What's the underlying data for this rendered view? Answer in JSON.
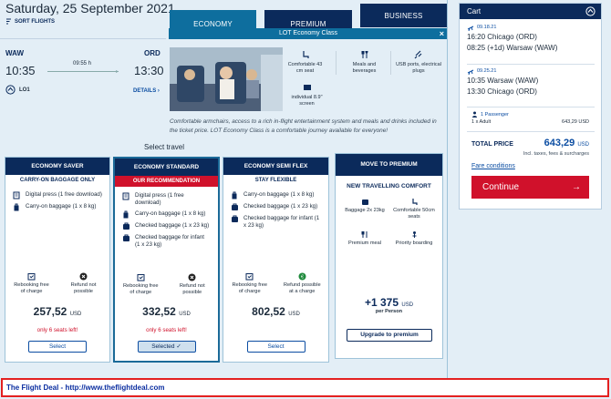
{
  "flight": {
    "date": "Saturday, 25 September 2021",
    "sort_label": "SORT FLIGHTS",
    "origin": "WAW",
    "destination": "ORD",
    "depart_time": "10:35",
    "arrive_time": "13:30",
    "duration": "09:55 h",
    "flight_no": "LO1",
    "details_label": "DETAILS"
  },
  "tabs": [
    {
      "label": "ECONOMY"
    },
    {
      "label": "PREMIUM"
    },
    {
      "label": "BUSINESS"
    }
  ],
  "economy_info": {
    "header": "LOT Economy Class",
    "close": "×",
    "features": [
      {
        "icon": "seat-icon",
        "label": "Comfortable 43 cm seat"
      },
      {
        "icon": "meal-icon",
        "label": "Meals and beverages"
      },
      {
        "icon": "usb-icon",
        "label": "USB ports, electrical plugs"
      },
      {
        "icon": "screen-icon",
        "label": "individual 8.9\" screen"
      }
    ],
    "description": "Comfortable armchairs, access to a rich in-flight entertainment system and meals and drinks included in the ticket price. LOT Economy Class is a comfortable journey available for everyone!"
  },
  "select_travel": "Select travel",
  "fares": [
    {
      "name": "ECONOMY SAVER",
      "subtitle": "CARRY-ON BAGGAGE ONLY",
      "items": [
        {
          "icon": "digital-press-icon",
          "text": "Digital press (1 free download)"
        },
        {
          "icon": "carry-on-bag-icon",
          "text": "Carry-on baggage (1 x 8 kg)"
        }
      ],
      "rebook": "Rebooking free of charge",
      "refund": "Refund not possible",
      "price": "257,52",
      "currency": "USD",
      "seats": "only 6 seats left!",
      "button": "Select"
    },
    {
      "name": "ECONOMY STANDARD",
      "subtitle": "OUR RECOMMENDATION",
      "items": [
        {
          "icon": "digital-press-icon",
          "text": "Digital press (1 free download)"
        },
        {
          "icon": "carry-on-bag-icon",
          "text": "Carry-on baggage (1 x 8 kg)"
        },
        {
          "icon": "checked-bag-icon",
          "text": "Checked baggage (1 x 23 kg)"
        },
        {
          "icon": "checked-bag-icon",
          "text": "Checked baggage for infant (1 x 23 kg)"
        }
      ],
      "rebook": "Rebooking free of charge",
      "refund": "Refund not possible",
      "price": "332,52",
      "currency": "USD",
      "seats": "only 6 seats left!",
      "button": "Selected ✓"
    },
    {
      "name": "ECONOMY SEMI FLEX",
      "subtitle": "STAY FLEXIBLE",
      "items": [
        {
          "icon": "carry-on-bag-icon",
          "text": "Carry-on baggage (1 x 8 kg)"
        },
        {
          "icon": "checked-bag-icon",
          "text": "Checked baggage (1 x 23 kg)"
        },
        {
          "icon": "checked-bag-icon",
          "text": "Checked baggage for infant (1 x 23 kg)"
        }
      ],
      "rebook": "Rebooking free of charge",
      "refund": "Refund possible at a charge",
      "price": "802,52",
      "currency": "USD",
      "seats": "",
      "button": "Select"
    }
  ],
  "premium_upsell": {
    "header": "MOVE TO PREMIUM",
    "title": "NEW TRAVELLING COMFORT",
    "features": [
      {
        "icon": "baggage-icon",
        "label": "Baggage 2x 23kg"
      },
      {
        "icon": "seat-icon",
        "label": "Comfortable 50cm seats"
      },
      {
        "icon": "premium-meal-icon",
        "label": "Premium meal"
      },
      {
        "icon": "priority-icon",
        "label": "Priority boarding"
      }
    ],
    "price": "+1 375",
    "currency": "USD",
    "per": "per Person",
    "button": "Upgrade to premium"
  },
  "cart": {
    "title": "Cart",
    "segments": [
      {
        "date": "09.18.21",
        "line1": "16:20  Chicago  (ORD)",
        "line2": "08:25  (+1d)  Warsaw  (WAW)"
      },
      {
        "date": "09.25.21",
        "line1": "10:35  Warsaw  (WAW)",
        "line2": "13:30  Chicago  (ORD)"
      }
    ],
    "passengers": "1 Passenger",
    "adult": "1  x  Adult",
    "adult_price": "643,29 USD",
    "total_label": "TOTAL PRICE",
    "total": "643,29",
    "total_currency": "USD",
    "taxes": "Incl. taxes, fees & surcharges",
    "fare_conditions": "Fare conditions",
    "continue": "Continue",
    "continue_arrow": "→"
  },
  "footer": {
    "text": "The Flight Deal - http://www.theflightdeal.com"
  },
  "colors": {
    "navy": "#0b2a5b",
    "teal": "#0e6e9e",
    "red": "#d0112b",
    "link": "#0b4da2"
  }
}
